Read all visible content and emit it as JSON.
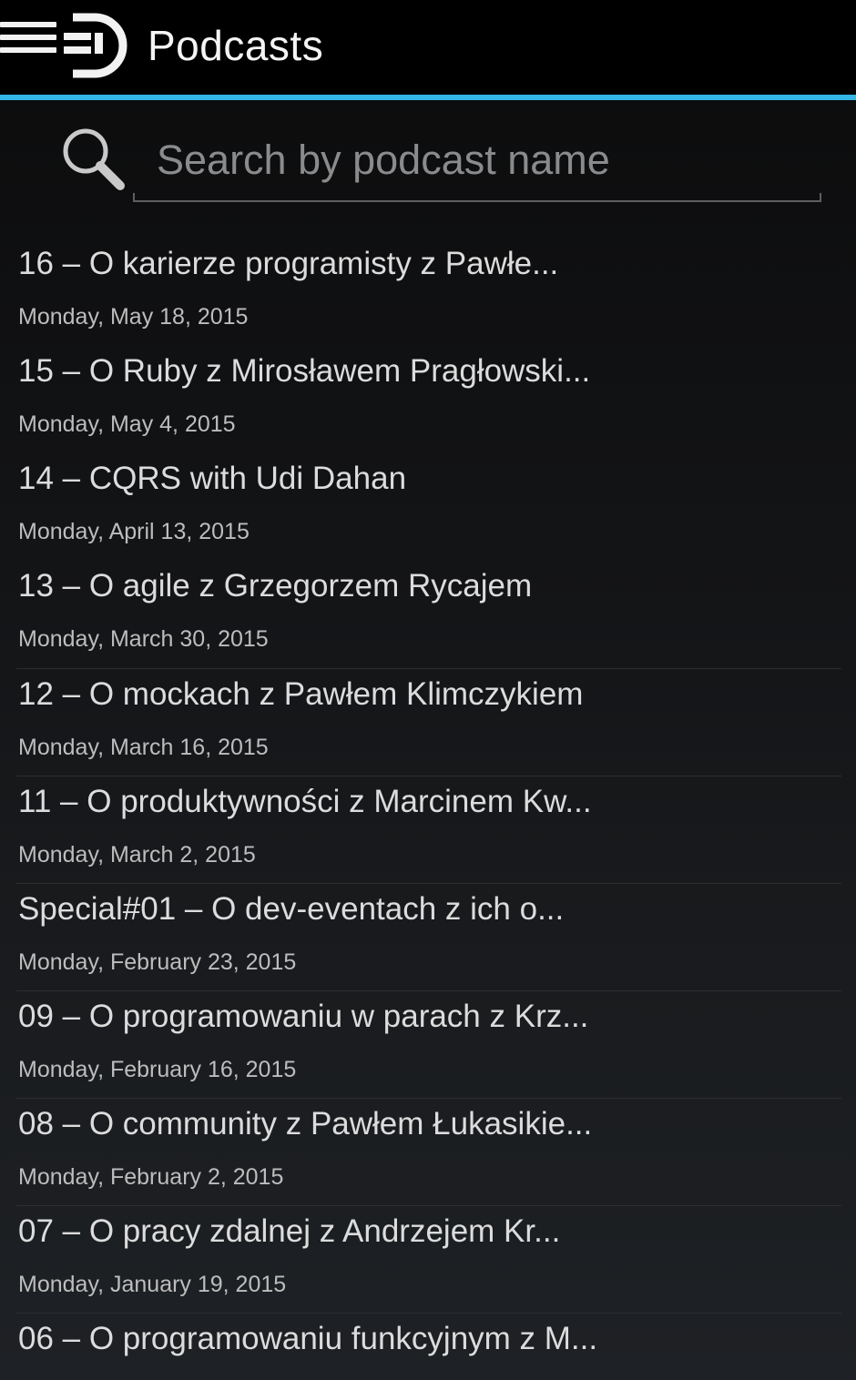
{
  "action_bar": {
    "title": "Podcasts",
    "menu_icon": "hamburger-menu-icon",
    "logo_icon": "app-logo-icon",
    "accent_color": "#33b5e5"
  },
  "search": {
    "icon": "search-icon",
    "placeholder": "Search by podcast name",
    "value": ""
  },
  "episodes": [
    {
      "title": "16 – O karierze programisty z Pawłe...",
      "date": "Monday, May 18, 2015"
    },
    {
      "title": "15 – O Ruby z Mirosławem Pragłowski...",
      "date": "Monday, May 4, 2015"
    },
    {
      "title": "14 – CQRS with Udi Dahan",
      "date": "Monday, April 13, 2015"
    },
    {
      "title": "13 – O agile z Grzegorzem Rycajem",
      "date": "Monday, March 30, 2015"
    },
    {
      "title": "12 – O mockach z Pawłem Klimczykiem",
      "date": "Monday, March 16, 2015"
    },
    {
      "title": "11 – O produktywności z Marcinem Kw...",
      "date": "Monday, March 2, 2015"
    },
    {
      "title": "Special#01 – O dev-eventach z ich o...",
      "date": "Monday, February 23, 2015"
    },
    {
      "title": "09 – O programowaniu w parach z Krz...",
      "date": "Monday, February 16, 2015"
    },
    {
      "title": "08 – O community z Pawłem Łukasikie...",
      "date": "Monday, February 2, 2015"
    },
    {
      "title": "07 – O pracy zdalnej z Andrzejem Kr...",
      "date": "Monday, January 19, 2015"
    },
    {
      "title": "06 – O programowaniu funkcyjnym z M...",
      "date": ""
    }
  ]
}
